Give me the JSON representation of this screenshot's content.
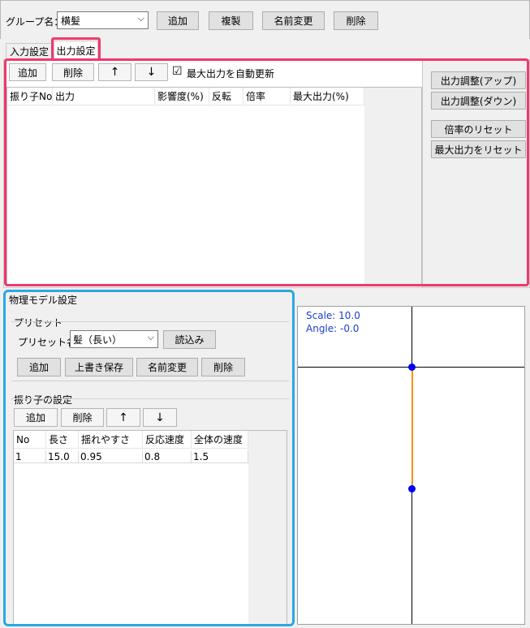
{
  "top": {
    "group_label": "グループ名：",
    "group_value": "横髪",
    "add": "追加",
    "duplicate": "複製",
    "rename": "名前変更",
    "delete": "削除"
  },
  "tabs": [
    "入力設定",
    "出力設定"
  ],
  "output": {
    "toolbar": {
      "add": "追加",
      "delete": "削除",
      "up": "↑",
      "down": "↓",
      "auto_update_label": "最大出力を自動更新",
      "auto_update_checked": "☑"
    },
    "columns": [
      "振り子No",
      "出力",
      "影響度(%)",
      "反転",
      "倍率",
      "最大出力(%)"
    ],
    "side_buttons": {
      "adjust_up": "出力調整(アップ)",
      "adjust_down": "出力調整(ダウン)",
      "reset_ratio": "倍率のリセット",
      "reset_max": "最大出力をリセット"
    }
  },
  "physics": {
    "title": "物理モデル設定",
    "preset_group": "プリセット",
    "preset_label": "プリセット名：",
    "preset_value": "髪（長い）",
    "load": "読込み",
    "preset_buttons": {
      "add": "追加",
      "overwrite": "上書き保存",
      "rename": "名前変更",
      "delete": "削除"
    },
    "pendulum_group": "振り子の設定",
    "pendulum_toolbar": {
      "add": "追加",
      "delete": "削除",
      "up": "↑",
      "down": "↓"
    },
    "columns": [
      "No",
      "長さ",
      "揺れやすさ",
      "反応速度",
      "全体の速度"
    ],
    "rows": [
      {
        "no": "1",
        "length": "15.0",
        "sway": "0.95",
        "reaction": "0.8",
        "speed": "1.5"
      }
    ]
  },
  "preview": {
    "scale": "Scale: 10.0",
    "angle": "Angle: -0.0",
    "line_color": "#ff8c1a",
    "point_color": "#0000ff"
  },
  "highlights": {
    "pink": "#f2386b",
    "blue": "#29a9e0"
  }
}
